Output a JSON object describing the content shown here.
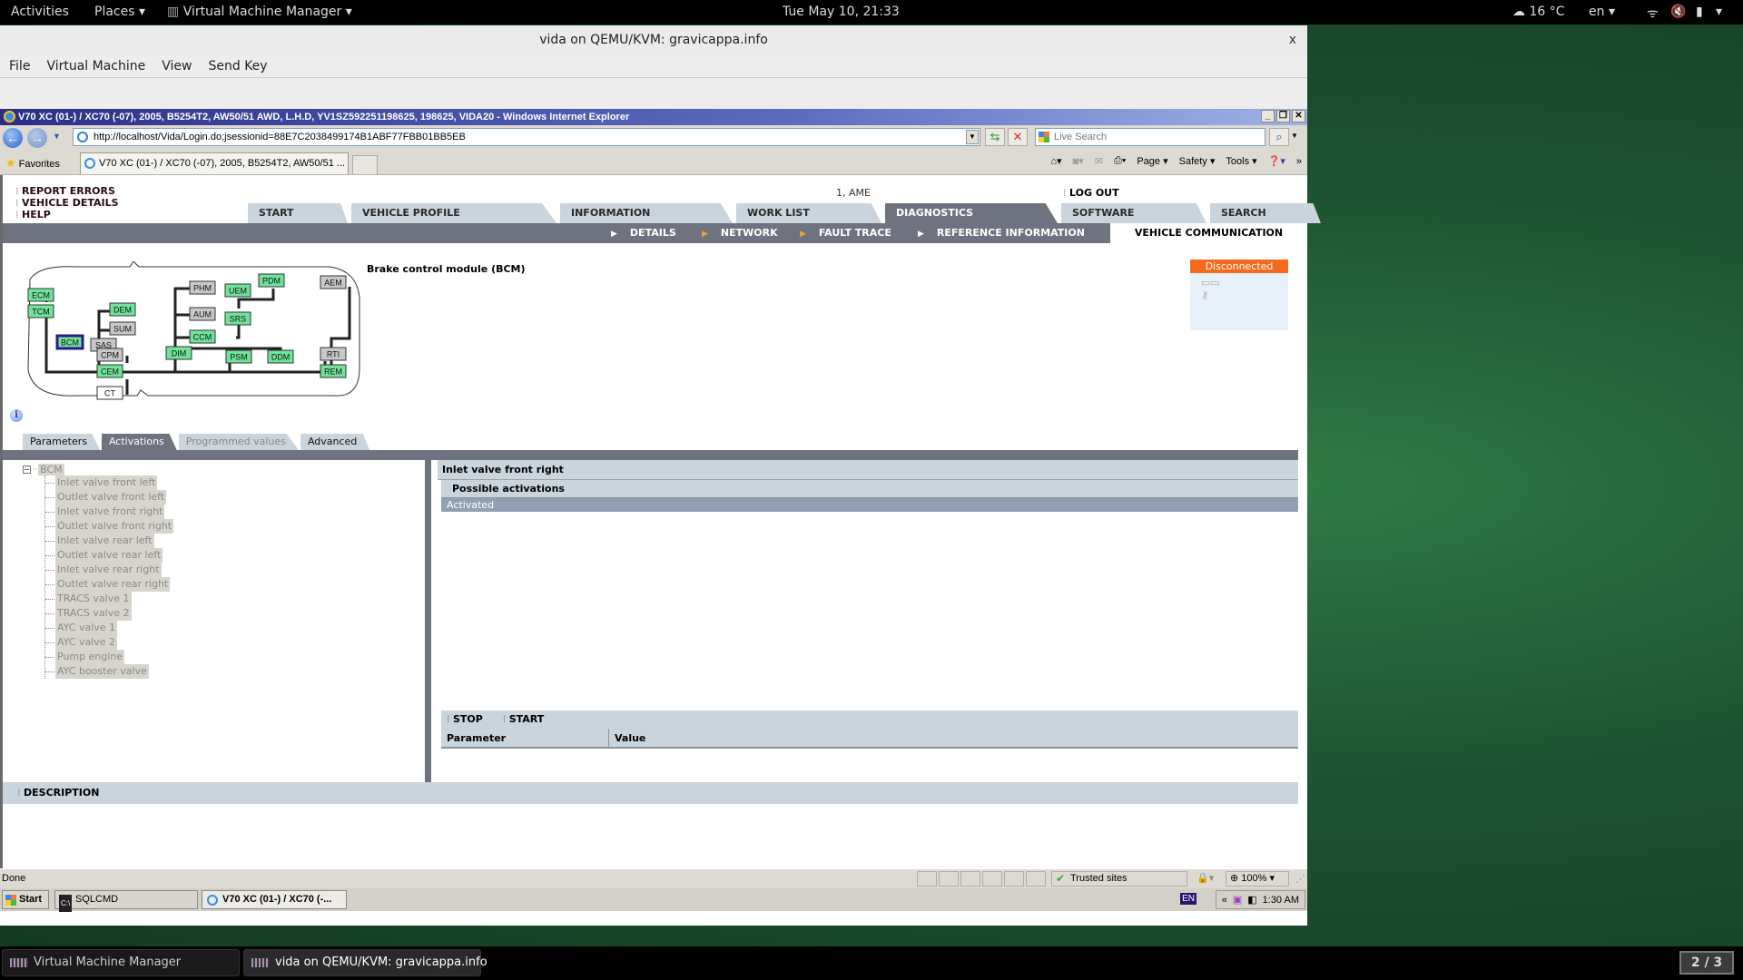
{
  "gnome_top_bar": {
    "activities": "Activities",
    "places": "Places",
    "app_menu": "Virtual Machine Manager",
    "clock": "Tue May 10, 21:33",
    "weather": "16 °C",
    "language": "en"
  },
  "vm_window": {
    "title": "vida on QEMU/KVM: gravicappa.info",
    "close": "x",
    "menu": [
      "File",
      "Virtual Machine",
      "View",
      "Send Key"
    ]
  },
  "ie": {
    "title": "V70 XC (01-) / XC70 (-07), 2005, B5254T2, AW50/51 AWD, L.H.D, YV1SZ592251198625, 198625, VIDA20 - Windows Internet Explorer",
    "url": "http://localhost/Vida/Login.do;jsessionid=88E7C2038499174B1ABF77FBB01BB5EB",
    "search_placeholder": "Live Search",
    "favorites": "Favorites",
    "tab_label": "V70 XC (01-) / XC70 (-07), 2005, B5254T2, AW50/51 ...",
    "command_bar": [
      "Page",
      "Safety",
      "Tools"
    ],
    "status_text": "Done",
    "zone": "Trusted sites",
    "zoom": "100%"
  },
  "vida": {
    "side_links": [
      "REPORT ERRORS",
      "VEHICLE DETAILS",
      "HELP"
    ],
    "user": "1, AME",
    "logout": "LOG OUT",
    "main_tabs": [
      {
        "label": "START",
        "active": false
      },
      {
        "label": "VEHICLE PROFILE",
        "active": false
      },
      {
        "label": "INFORMATION",
        "active": false
      },
      {
        "label": "WORK LIST",
        "active": false
      },
      {
        "label": "DIAGNOSTICS",
        "active": true
      },
      {
        "label": "SOFTWARE",
        "active": false
      },
      {
        "label": "SEARCH",
        "active": false
      }
    ],
    "sub_nav": [
      "DETAILS",
      "NETWORK",
      "FAULT TRACE",
      "REFERENCE INFORMATION"
    ],
    "sub_nav_active": "VEHICLE COMMUNICATION",
    "module_title": "Brake control module (BCM)",
    "connection_status": "Disconnected",
    "network_modules": [
      {
        "name": "ECM",
        "state": "green"
      },
      {
        "name": "TCM",
        "state": "green"
      },
      {
        "name": "BCM",
        "state": "selected"
      },
      {
        "name": "SAS",
        "state": "grey"
      },
      {
        "name": "DEM",
        "state": "green"
      },
      {
        "name": "SUM",
        "state": "grey"
      },
      {
        "name": "CPM",
        "state": "grey"
      },
      {
        "name": "CEM",
        "state": "green"
      },
      {
        "name": "CT",
        "state": "white"
      },
      {
        "name": "PHM",
        "state": "grey"
      },
      {
        "name": "AUM",
        "state": "grey"
      },
      {
        "name": "CCM",
        "state": "green"
      },
      {
        "name": "DIM",
        "state": "green"
      },
      {
        "name": "UEM",
        "state": "green"
      },
      {
        "name": "PDM",
        "state": "green"
      },
      {
        "name": "SRS",
        "state": "green"
      },
      {
        "name": "PSM",
        "state": "green"
      },
      {
        "name": "DDM",
        "state": "green"
      },
      {
        "name": "AEM",
        "state": "grey"
      },
      {
        "name": "RTI",
        "state": "grey"
      },
      {
        "name": "REM",
        "state": "green"
      }
    ],
    "sub_tabs": [
      {
        "label": "Parameters",
        "state": "normal"
      },
      {
        "label": "Activations",
        "state": "active"
      },
      {
        "label": "Programmed values",
        "state": "disabled"
      },
      {
        "label": "Advanced",
        "state": "normal"
      }
    ],
    "tree": {
      "root": "BCM",
      "items": [
        "Inlet valve front left",
        "Outlet valve front left",
        "Inlet valve front right",
        "Outlet valve front right",
        "Inlet valve rear left",
        "Outlet valve rear left",
        "Inlet valve rear right",
        "Outlet valve rear right",
        "TRACS valve 1",
        "TRACS valve 2",
        "AYC valve 1",
        "AYC valve 2",
        "Pump engine",
        "AYC booster valve"
      ]
    },
    "detail": {
      "title": "Inlet valve front right",
      "possible_header": "Possible activations",
      "activations": [
        "Activated"
      ],
      "buttons": [
        "STOP",
        "START"
      ],
      "columns": [
        "Parameter",
        "Value"
      ]
    },
    "description": "DESCRIPTION"
  },
  "xp_taskbar": {
    "start": "Start",
    "items": [
      {
        "label": "SQLCMD",
        "selected": false
      },
      {
        "label": "V70 XC (01-) / XC70 (-...",
        "selected": true
      }
    ],
    "lang": "EN",
    "clock": "1:30 AM"
  },
  "gnome_taskbar": {
    "items": [
      {
        "label": "Virtual Machine Manager",
        "active": false
      },
      {
        "label": "vida on QEMU/KVM: gravicappa.info",
        "active": true
      }
    ],
    "workspace": "2 / 3"
  }
}
